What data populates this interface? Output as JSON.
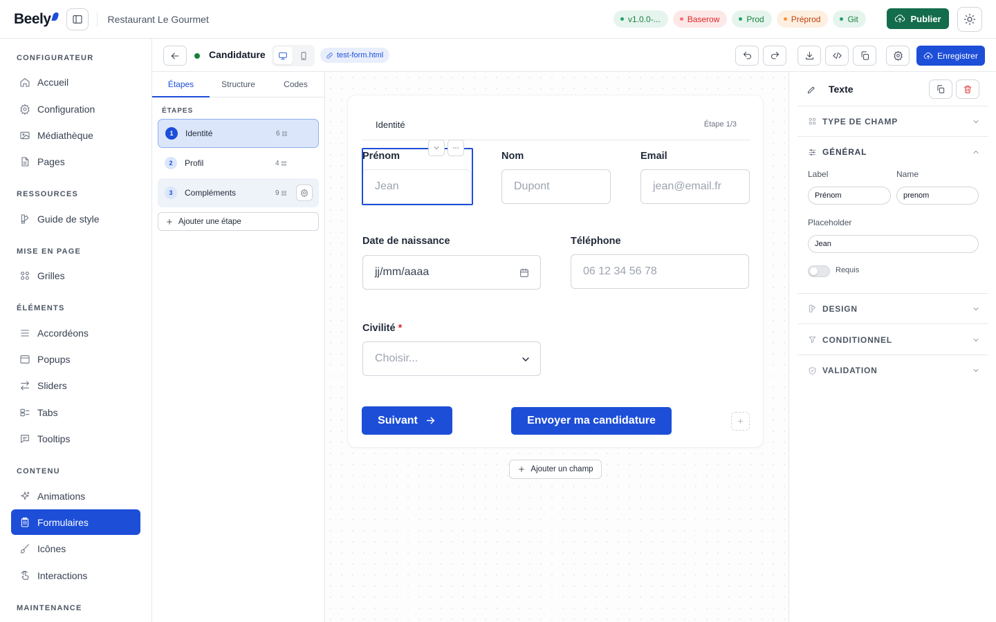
{
  "topbar": {
    "brand": "Beely",
    "site_name": "Restaurant Le Gourmet",
    "badges": [
      {
        "label": "v1.0.0-...",
        "bg": "#e6f4ee",
        "color": "#15803d",
        "dot": "#22a06b"
      },
      {
        "label": "Baserow",
        "bg": "#fde8e8",
        "color": "#dc2626",
        "dot": "#f87171"
      },
      {
        "label": "Prod",
        "bg": "#e6f4ee",
        "color": "#15803d",
        "dot": "#22a06b"
      },
      {
        "label": "Préprod",
        "bg": "#fdf0e1",
        "color": "#c2410c",
        "dot": "#fb923c"
      },
      {
        "label": "Git",
        "bg": "#e6f4ee",
        "color": "#15803d",
        "dot": "#22a06b"
      }
    ],
    "publish_label": "Publier"
  },
  "sidebar": {
    "sections": [
      {
        "title": "CONFIGURATEUR",
        "items": [
          {
            "label": "Accueil",
            "icon": "home-icon"
          },
          {
            "label": "Configuration",
            "icon": "gear-icon"
          },
          {
            "label": "Médiathèque",
            "icon": "image-icon"
          },
          {
            "label": "Pages",
            "icon": "file-icon"
          }
        ]
      },
      {
        "title": "RESSOURCES",
        "items": [
          {
            "label": "Guide de style",
            "icon": "palette-icon"
          }
        ]
      },
      {
        "title": "MISE EN PAGE",
        "items": [
          {
            "label": "Grilles",
            "icon": "grid-icon"
          }
        ]
      },
      {
        "title": "ÉLÉMENTS",
        "items": [
          {
            "label": "Accordéons",
            "icon": "list-icon"
          },
          {
            "label": "Popups",
            "icon": "window-icon"
          },
          {
            "label": "Sliders",
            "icon": "arrows-icon"
          },
          {
            "label": "Tabs",
            "icon": "tabs-icon"
          },
          {
            "label": "Tooltips",
            "icon": "message-icon"
          }
        ]
      },
      {
        "title": "CONTENU",
        "items": [
          {
            "label": "Animations",
            "icon": "sparkle-icon"
          },
          {
            "label": "Formulaires",
            "icon": "form-icon",
            "active": true
          },
          {
            "label": "Icônes",
            "icon": "brush-icon"
          },
          {
            "label": "Interactions",
            "icon": "pointer-icon"
          }
        ]
      },
      {
        "title": "MAINTENANCE",
        "items": []
      }
    ]
  },
  "editor": {
    "form_name": "Candidature",
    "file_name": "test-form.html",
    "save_label": "Enregistrer"
  },
  "steps_panel": {
    "tabs": [
      "Étapes",
      "Structure",
      "Codes"
    ],
    "label": "ÉTAPES",
    "steps": [
      {
        "num": "1",
        "name": "Identité",
        "count": "6"
      },
      {
        "num": "2",
        "name": "Profil",
        "count": "4"
      },
      {
        "num": "3",
        "name": "Compléments",
        "count": "9"
      }
    ],
    "add_step": "Ajouter une étape"
  },
  "form": {
    "step_title": "Identité",
    "step_indicator": "Étape 1/3",
    "fields": {
      "prenom": {
        "label": "Prénom",
        "placeholder": "Jean"
      },
      "nom": {
        "label": "Nom",
        "placeholder": "Dupont"
      },
      "email": {
        "label": "Email",
        "placeholder": "jean@email.fr"
      },
      "dob": {
        "label": "Date de naissance",
        "value": "jj/mm/aaaa"
      },
      "tel": {
        "label": "Téléphone",
        "placeholder": "06 12 34 56 78"
      },
      "civilite": {
        "label": "Civilité",
        "required": "*",
        "placeholder": "Choisir..."
      }
    },
    "next_label": "Suivant",
    "submit_label": "Envoyer ma candidature",
    "add_field": "Ajouter un champ"
  },
  "props": {
    "title": "Texte",
    "sections": {
      "type": "TYPE DE CHAMP",
      "general": "GÉNÉRAL",
      "design": "DESIGN",
      "conditional": "CONDITIONNEL",
      "validation": "VALIDATION"
    },
    "label_caption": "Label",
    "label_value": "Prénom",
    "name_caption": "Name",
    "name_value": "prenom",
    "placeholder_caption": "Placeholder",
    "placeholder_value": "Jean",
    "required_label": "Requis"
  }
}
